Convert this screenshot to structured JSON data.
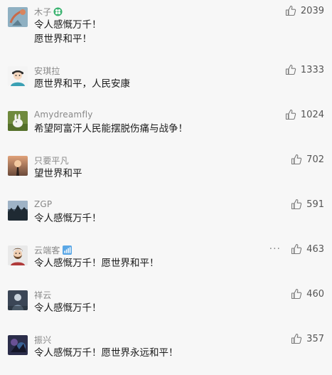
{
  "comments": [
    {
      "name": "木子",
      "badge": "clover-icon",
      "text": "令人感慨万千！\n愿世界和平！",
      "likes": "2039"
    },
    {
      "name": "安琪拉",
      "text": "愿世界和平，人民安康",
      "likes": "1333"
    },
    {
      "name": "Amydreamfly",
      "text": "希望阿富汗人民能摆脱伤痛与战争！",
      "likes": "1024"
    },
    {
      "name": "只要平凡",
      "text": "望世界和平",
      "likes": "702"
    },
    {
      "name": "ZGP",
      "text": "令人感慨万千！",
      "likes": "591"
    },
    {
      "name": "云端客",
      "badge": "signal-bars-icon",
      "text": "令人感慨万千！愿世界和平！",
      "likes": "463",
      "more": "···"
    },
    {
      "name": "祥云",
      "text": "令人感慨万千！",
      "likes": "460"
    },
    {
      "name": "振兴",
      "text": "令人感慨万千！愿世界永远和平！",
      "likes": "357"
    }
  ],
  "colors": {
    "background": "#f7f7f7",
    "name": "#888888",
    "text": "#1a1a1a",
    "like_icon": "#7a7a7a"
  }
}
